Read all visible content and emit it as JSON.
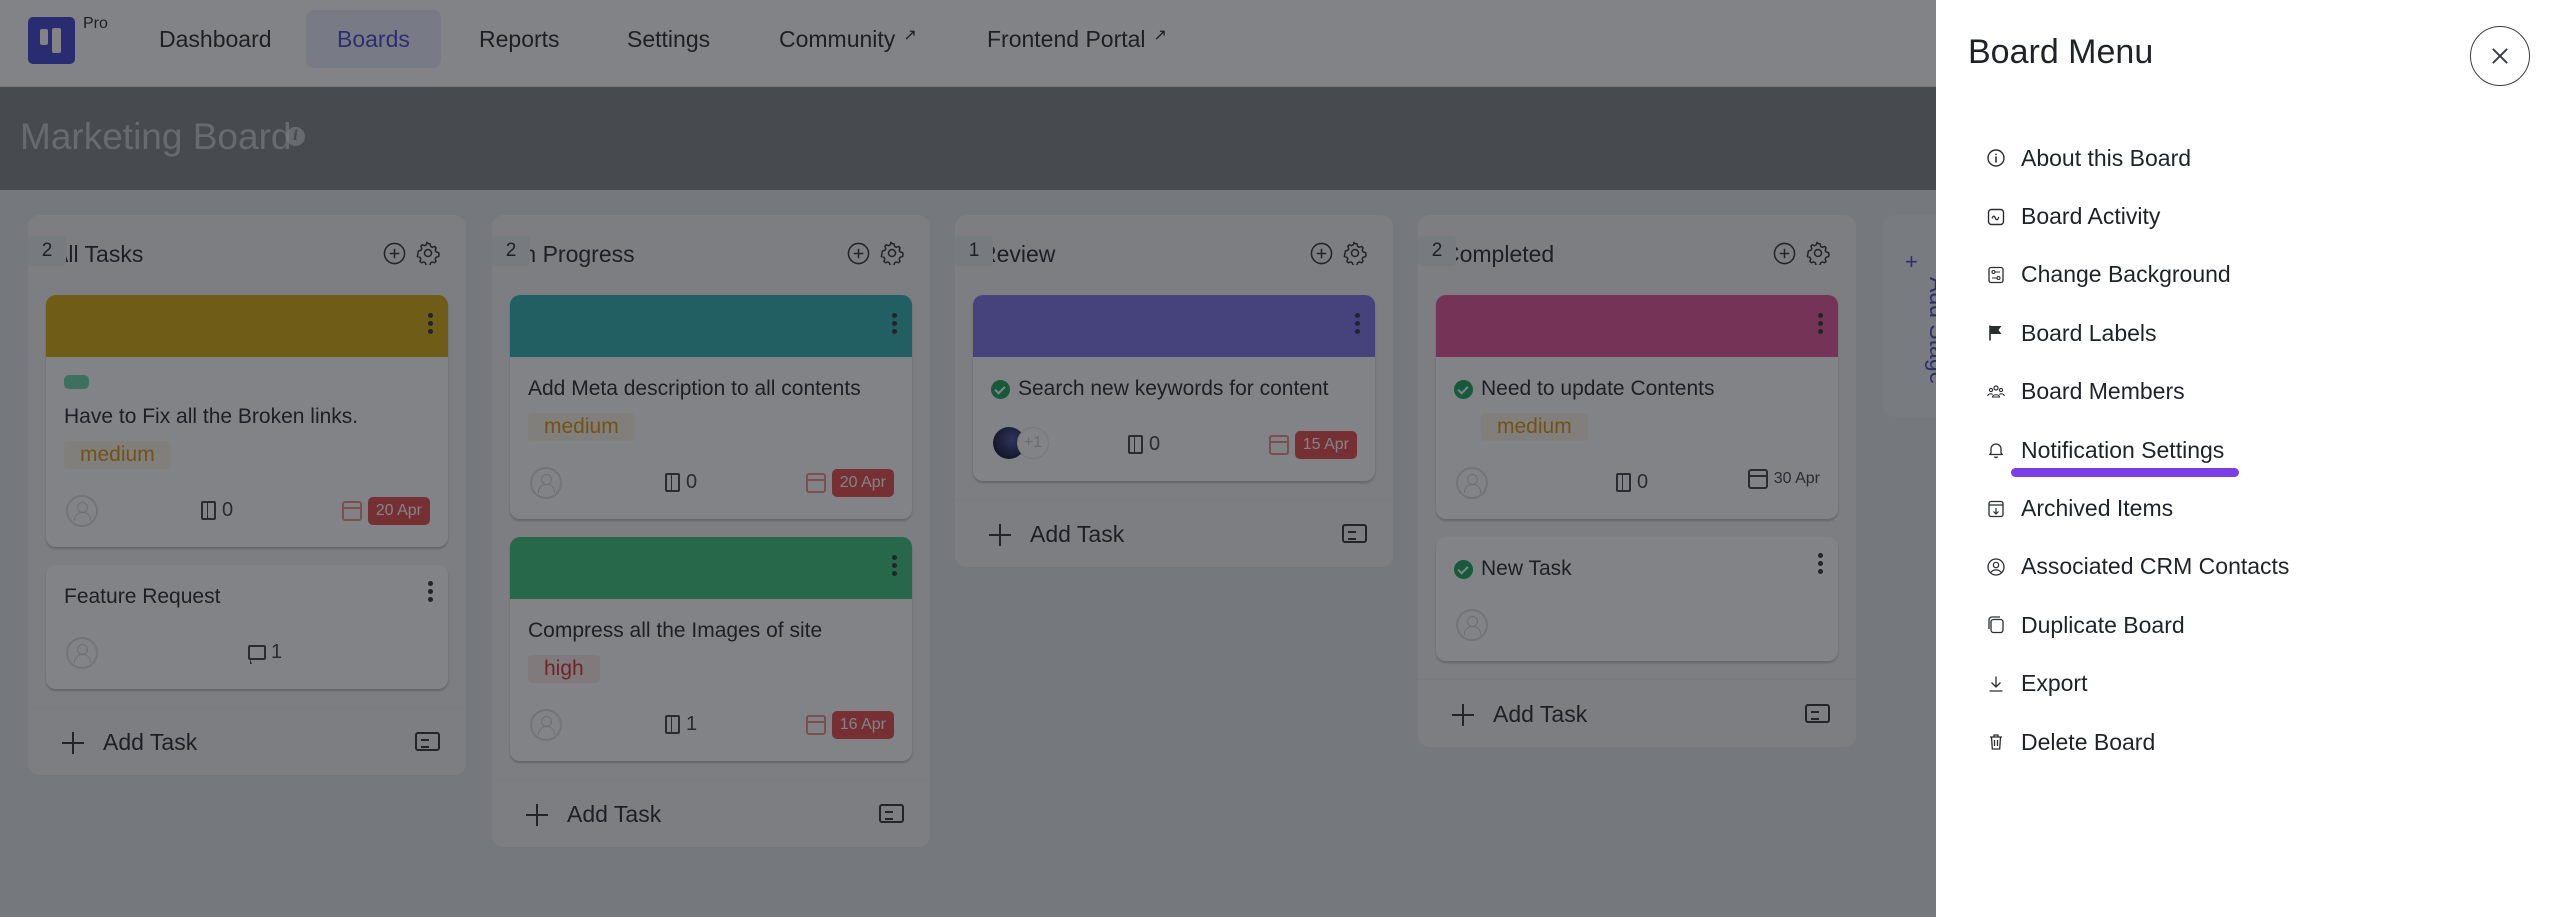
{
  "nav": {
    "logo_badge": "Pro",
    "items": [
      {
        "label": "Dashboard",
        "active": false,
        "external": false
      },
      {
        "label": "Boards",
        "active": true,
        "external": false
      },
      {
        "label": "Reports",
        "active": false,
        "external": false
      },
      {
        "label": "Settings",
        "active": false,
        "external": false
      },
      {
        "label": "Community",
        "active": false,
        "external": true
      },
      {
        "label": "Frontend Portal",
        "active": false,
        "external": true
      }
    ],
    "external_icon": "↗"
  },
  "board": {
    "title": "Marketing Board",
    "info_icon": "i"
  },
  "columns": [
    {
      "title": "All Tasks",
      "count": "2",
      "add_task_label": "Add Task",
      "cards": [
        {
          "cover_color": "#d4a90a",
          "has_tag_chip": true,
          "completed": false,
          "title": "Have to Fix all the Broken links.",
          "priority": "medium",
          "assignee": "none",
          "attachments": "0",
          "comments": null,
          "due": "20 Apr",
          "overdue": true
        },
        {
          "cover_color": null,
          "has_tag_chip": false,
          "completed": false,
          "title": "Feature Request",
          "priority": null,
          "assignee": "none",
          "attachments": null,
          "comments": "1",
          "due": null,
          "overdue": false
        }
      ]
    },
    {
      "title": "In Progress",
      "count": "2",
      "add_task_label": "Add Task",
      "cards": [
        {
          "cover_color": "#2bb0b0",
          "has_tag_chip": false,
          "completed": false,
          "title": "Add Meta description to all contents",
          "priority": "medium",
          "assignee": "none",
          "attachments": "0",
          "comments": null,
          "due": "20 Apr",
          "overdue": true
        },
        {
          "cover_color": "#39c07a",
          "has_tag_chip": false,
          "completed": false,
          "title": "Compress all the Images of site",
          "priority": "high",
          "assignee": "none",
          "attachments": "1",
          "comments": null,
          "due": "16 Apr",
          "overdue": true
        }
      ]
    },
    {
      "title": "Review",
      "count": "1",
      "add_task_label": "Add Task",
      "cards": [
        {
          "cover_color": "#7b6fe8",
          "has_tag_chip": false,
          "completed": true,
          "title": "Search new keywords for content",
          "priority": null,
          "assignee": "avatar",
          "assignee_more": "+1",
          "attachments": "0",
          "comments": null,
          "due": "15 Apr",
          "overdue": true
        }
      ]
    },
    {
      "title": "Completed",
      "count": "2",
      "add_task_label": "Add Task",
      "cards": [
        {
          "cover_color": "#e24f97",
          "has_tag_chip": false,
          "completed": true,
          "title": "Need to update Contents",
          "priority": "medium",
          "assignee": "none",
          "attachments": "0",
          "comments": null,
          "due": "30 Apr",
          "overdue": false
        },
        {
          "cover_color": null,
          "has_tag_chip": false,
          "completed": true,
          "title": "New Task",
          "priority": null,
          "assignee": "none",
          "attachments": null,
          "comments": null,
          "due": null,
          "overdue": false
        }
      ]
    }
  ],
  "add_stage": {
    "label": "Add Stage",
    "icon": "+"
  },
  "panel": {
    "title": "Board Menu",
    "close_icon": "close-icon",
    "highlighted_item": "Notification Settings",
    "highlight_color": "#7a3de6",
    "items": [
      {
        "label": "About this Board",
        "icon": "info-icon"
      },
      {
        "label": "Board Activity",
        "icon": "activity-icon"
      },
      {
        "label": "Change Background",
        "icon": "sliders-icon"
      },
      {
        "label": "Board Labels",
        "icon": "flag-icon"
      },
      {
        "label": "Board Members",
        "icon": "members-icon"
      },
      {
        "label": "Notification Settings",
        "icon": "bell-icon"
      },
      {
        "label": "Archived Items",
        "icon": "archive-icon"
      },
      {
        "label": "Associated CRM Contacts",
        "icon": "user-circle-icon"
      },
      {
        "label": "Duplicate Board",
        "icon": "duplicate-icon"
      },
      {
        "label": "Export",
        "icon": "download-icon"
      },
      {
        "label": "Delete Board",
        "icon": "trash-icon"
      }
    ]
  },
  "colors": {
    "brand": "#3f3fd1",
    "overdue": "#e6474a",
    "priority_medium": "#e3920b",
    "priority_high": "#d92e2e",
    "completed_check": "#12a35a"
  }
}
